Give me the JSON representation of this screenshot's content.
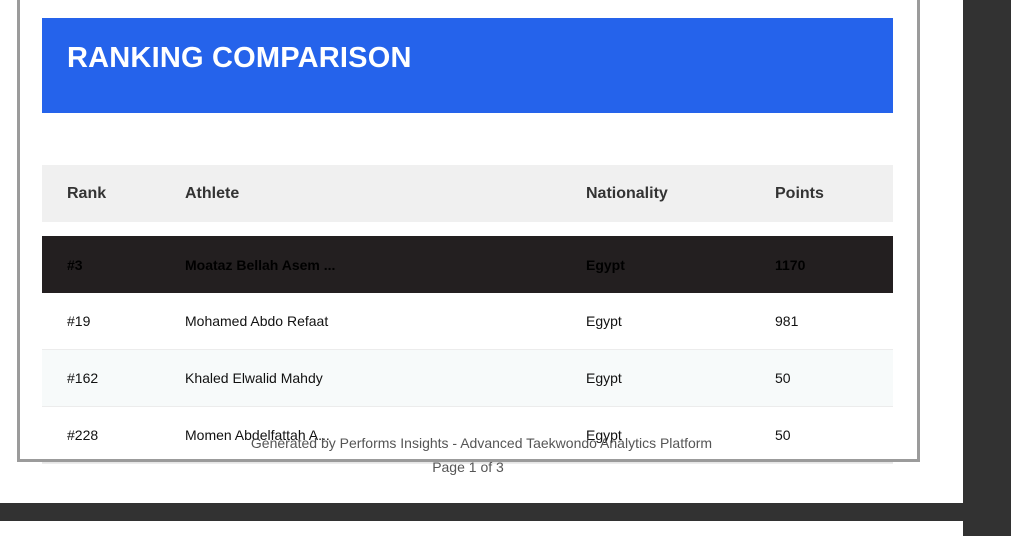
{
  "report": {
    "title": "RANKING COMPARISON",
    "columns": {
      "rank": "Rank",
      "athlete": "Athlete",
      "nationality": "Nationality",
      "points": "Points"
    },
    "rows": [
      {
        "rank": "#3",
        "athlete": "Moataz Bellah Asem ...",
        "nationality": "Egypt",
        "points": "1170",
        "highlighted": true
      },
      {
        "rank": "#19",
        "athlete": "Mohamed Abdo Refaat",
        "nationality": "Egypt",
        "points": "981"
      },
      {
        "rank": "#162",
        "athlete": "Khaled Elwalid Mahdy",
        "nationality": "Egypt",
        "points": "50"
      },
      {
        "rank": "#228",
        "athlete": "Momen Abdelfattah A...",
        "nationality": "Egypt",
        "points": "50"
      }
    ],
    "footer": {
      "generated_by": "Generated by Performs Insights - Advanced Taekwondo Analytics Platform",
      "page_label": "Page 1 of 3"
    }
  },
  "colors": {
    "header_banner": "#2563eb",
    "highlight_row": "#231f20",
    "viewer_background": "#323232"
  }
}
